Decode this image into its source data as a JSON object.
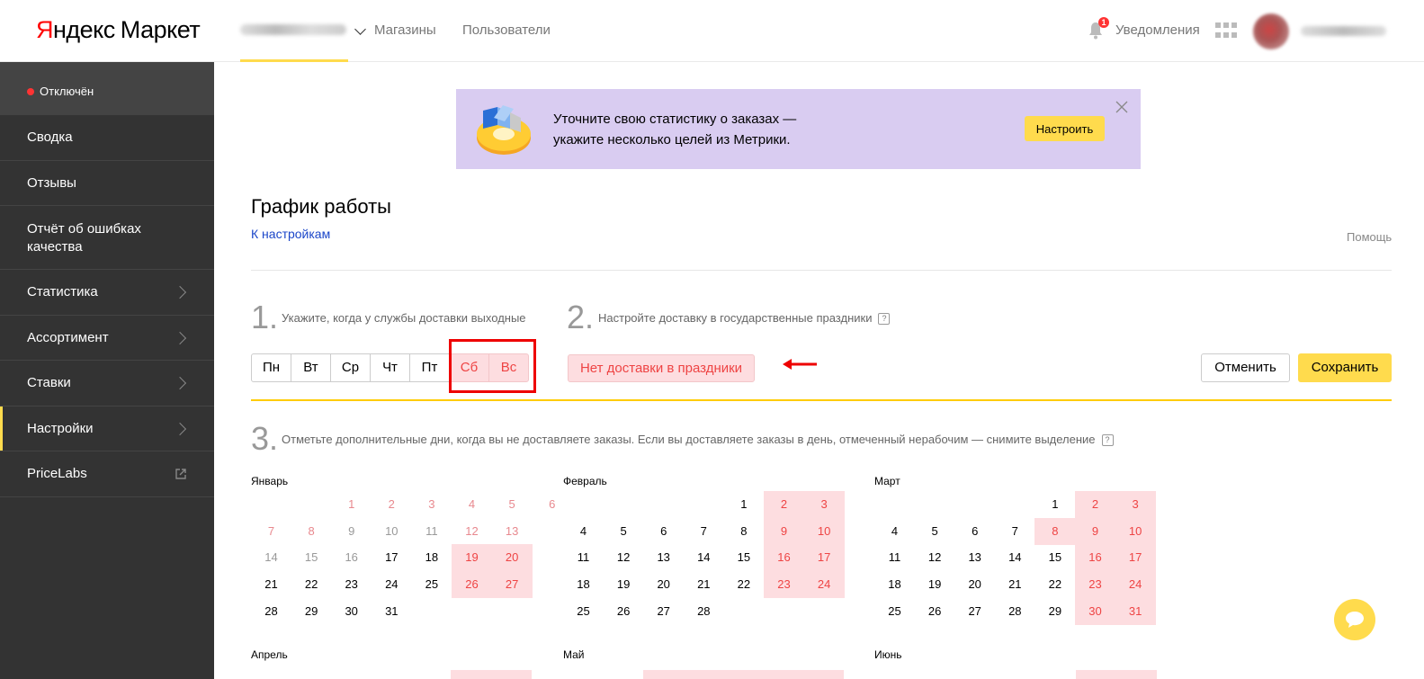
{
  "header": {
    "logo_ya": "Яндекс",
    "logo_market": "Маркет",
    "nav": [
      "Магазины",
      "Пользователи"
    ],
    "notifications_label": "Уведомления",
    "notifications_count": "1"
  },
  "sidebar": {
    "status": "Отключён",
    "items": [
      {
        "label": "Сводка"
      },
      {
        "label": "Отзывы"
      },
      {
        "label": "Отчёт об ошибках качества"
      },
      {
        "label": "Статистика"
      },
      {
        "label": "Ассортимент"
      },
      {
        "label": "Ставки"
      },
      {
        "label": "Настройки"
      },
      {
        "label": "PriceLabs"
      }
    ]
  },
  "banner": {
    "line1": "Уточните свою статистику о заказах —",
    "line2": "укажите несколько целей из Метрики.",
    "button": "Настроить"
  },
  "page": {
    "title": "График работы",
    "back_link": "К настройкам",
    "help": "Помощь"
  },
  "step1": {
    "num": "1.",
    "text": "Укажите, когда у службы доставки выходные"
  },
  "step2": {
    "num": "2.",
    "text": "Настройте доставку в государственные праздники"
  },
  "step3": {
    "num": "3.",
    "text": "Отметьте дополнительные дни, когда вы не доставляете заказы. Если вы доставляете заказы в день, отмеченный нерабочим — снимите выделение"
  },
  "weekdays": [
    {
      "label": "Пн",
      "off": false
    },
    {
      "label": "Вт",
      "off": false
    },
    {
      "label": "Ср",
      "off": false
    },
    {
      "label": "Чт",
      "off": false
    },
    {
      "label": "Пт",
      "off": false
    },
    {
      "label": "Сб",
      "off": true
    },
    {
      "label": "Вс",
      "off": true
    }
  ],
  "holiday_button": "Нет доставки в праздники",
  "cancel": "Отменить",
  "save": "Сохранить",
  "colors": {
    "accent": "#ffdb4d",
    "offday_bg": "#fddde0",
    "offday_text": "#e44",
    "link": "#1b46c9"
  },
  "months": [
    {
      "name": "Январь",
      "weeks": [
        [
          null,
          null,
          {
            "d": "1",
            "s": "pastwe"
          },
          {
            "d": "2",
            "s": "pastwe"
          },
          {
            "d": "3",
            "s": "pastwe"
          },
          {
            "d": "4",
            "s": "pastwe"
          },
          {
            "d": "5",
            "s": "pastwe"
          },
          {
            "d": "6",
            "s": "pastwe"
          }
        ],
        [
          {
            "d": "7",
            "s": "pastwe"
          },
          {
            "d": "8",
            "s": "pastwe"
          },
          {
            "d": "9",
            "s": "past"
          },
          {
            "d": "10",
            "s": "past"
          },
          {
            "d": "11",
            "s": "past"
          },
          {
            "d": "12",
            "s": "pastwe"
          },
          {
            "d": "13",
            "s": "pastwe"
          }
        ],
        [
          {
            "d": "14",
            "s": "past"
          },
          {
            "d": "15",
            "s": "past"
          },
          {
            "d": "16",
            "s": "past"
          },
          {
            "d": "17",
            "s": ""
          },
          {
            "d": "18",
            "s": ""
          },
          {
            "d": "19",
            "s": "sel"
          },
          {
            "d": "20",
            "s": "sel"
          }
        ],
        [
          {
            "d": "21",
            "s": ""
          },
          {
            "d": "22",
            "s": ""
          },
          {
            "d": "23",
            "s": ""
          },
          {
            "d": "24",
            "s": ""
          },
          {
            "d": "25",
            "s": ""
          },
          {
            "d": "26",
            "s": "sel"
          },
          {
            "d": "27",
            "s": "sel"
          }
        ],
        [
          {
            "d": "28",
            "s": ""
          },
          {
            "d": "29",
            "s": ""
          },
          {
            "d": "30",
            "s": ""
          },
          {
            "d": "31",
            "s": ""
          }
        ]
      ]
    },
    {
      "name": "Февраль",
      "weeks": [
        [
          null,
          null,
          null,
          null,
          {
            "d": "1",
            "s": ""
          },
          {
            "d": "2",
            "s": "sel"
          },
          {
            "d": "3",
            "s": "sel"
          }
        ],
        [
          {
            "d": "4",
            "s": ""
          },
          {
            "d": "5",
            "s": ""
          },
          {
            "d": "6",
            "s": ""
          },
          {
            "d": "7",
            "s": ""
          },
          {
            "d": "8",
            "s": ""
          },
          {
            "d": "9",
            "s": "sel"
          },
          {
            "d": "10",
            "s": "sel"
          }
        ],
        [
          {
            "d": "11",
            "s": ""
          },
          {
            "d": "12",
            "s": ""
          },
          {
            "d": "13",
            "s": ""
          },
          {
            "d": "14",
            "s": ""
          },
          {
            "d": "15",
            "s": ""
          },
          {
            "d": "16",
            "s": "sel"
          },
          {
            "d": "17",
            "s": "sel"
          }
        ],
        [
          {
            "d": "18",
            "s": ""
          },
          {
            "d": "19",
            "s": ""
          },
          {
            "d": "20",
            "s": ""
          },
          {
            "d": "21",
            "s": ""
          },
          {
            "d": "22",
            "s": ""
          },
          {
            "d": "23",
            "s": "sel"
          },
          {
            "d": "24",
            "s": "sel"
          }
        ],
        [
          {
            "d": "25",
            "s": ""
          },
          {
            "d": "26",
            "s": ""
          },
          {
            "d": "27",
            "s": ""
          },
          {
            "d": "28",
            "s": ""
          }
        ]
      ]
    },
    {
      "name": "Март",
      "weeks": [
        [
          null,
          null,
          null,
          null,
          {
            "d": "1",
            "s": ""
          },
          {
            "d": "2",
            "s": "sel"
          },
          {
            "d": "3",
            "s": "sel"
          }
        ],
        [
          {
            "d": "4",
            "s": ""
          },
          {
            "d": "5",
            "s": ""
          },
          {
            "d": "6",
            "s": ""
          },
          {
            "d": "7",
            "s": ""
          },
          {
            "d": "8",
            "s": "sel"
          },
          {
            "d": "9",
            "s": "sel"
          },
          {
            "d": "10",
            "s": "sel"
          }
        ],
        [
          {
            "d": "11",
            "s": ""
          },
          {
            "d": "12",
            "s": ""
          },
          {
            "d": "13",
            "s": ""
          },
          {
            "d": "14",
            "s": ""
          },
          {
            "d": "15",
            "s": ""
          },
          {
            "d": "16",
            "s": "sel"
          },
          {
            "d": "17",
            "s": "sel"
          }
        ],
        [
          {
            "d": "18",
            "s": ""
          },
          {
            "d": "19",
            "s": ""
          },
          {
            "d": "20",
            "s": ""
          },
          {
            "d": "21",
            "s": ""
          },
          {
            "d": "22",
            "s": ""
          },
          {
            "d": "23",
            "s": "sel"
          },
          {
            "d": "24",
            "s": "sel"
          }
        ],
        [
          {
            "d": "25",
            "s": ""
          },
          {
            "d": "26",
            "s": ""
          },
          {
            "d": "27",
            "s": ""
          },
          {
            "d": "28",
            "s": ""
          },
          {
            "d": "29",
            "s": ""
          },
          {
            "d": "30",
            "s": "sel"
          },
          {
            "d": "31",
            "s": "sel"
          }
        ]
      ]
    },
    {
      "name": "Апрель",
      "weeks": []
    },
    {
      "name": "Май",
      "weeks": []
    },
    {
      "name": "Июнь",
      "weeks": []
    }
  ]
}
